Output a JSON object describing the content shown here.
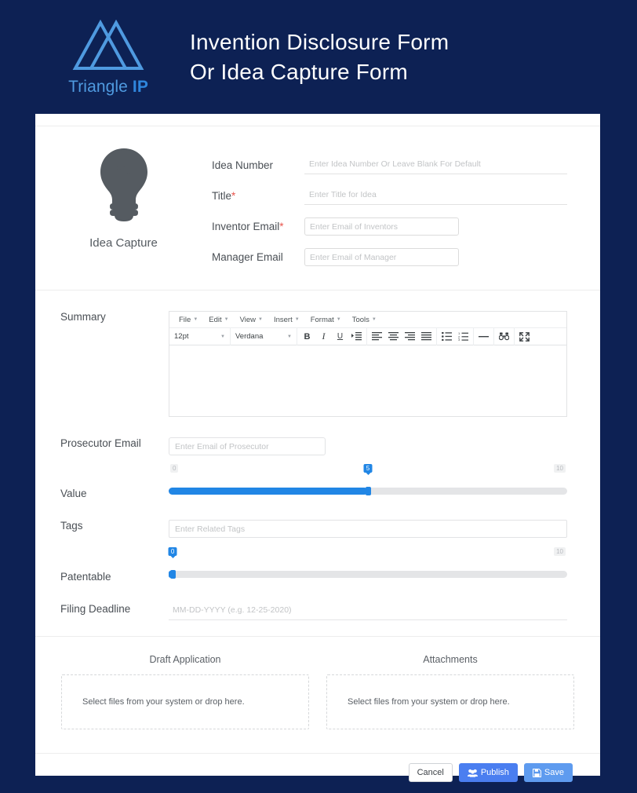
{
  "brand": {
    "logo_icon": "triangle-ip-logo-icon",
    "name_light": "Triangle ",
    "name_bold": "IP"
  },
  "header": {
    "title_line1": "Invention Disclosure Form",
    "title_line2": "Or Idea Capture Form"
  },
  "idea_capture": {
    "icon": "lightbulb-icon",
    "label": "Idea Capture"
  },
  "fields": {
    "idea_number": {
      "label": "Idea Number",
      "placeholder": "Enter Idea Number Or Leave Blank For Default",
      "value": ""
    },
    "title": {
      "label": "Title",
      "required": "*",
      "placeholder": "Enter Title for Idea",
      "value": ""
    },
    "inventor_email": {
      "label": "Inventor Email",
      "required": "*",
      "placeholder": "Enter Email of Inventors",
      "value": ""
    },
    "manager_email": {
      "label": "Manager Email",
      "placeholder": "Enter Email of Manager",
      "value": ""
    },
    "summary": {
      "label": "Summary",
      "value": ""
    },
    "prosecutor_email": {
      "label": "Prosecutor Email",
      "placeholder": "Enter Email of Prosecutor",
      "value": ""
    },
    "value": {
      "label": "Value"
    },
    "tags": {
      "label": "Tags",
      "placeholder": "Enter Related Tags",
      "value": ""
    },
    "patentable": {
      "label": "Patentable"
    },
    "filing_deadline": {
      "label": "Filing Deadline",
      "placeholder": "MM-DD-YYYY (e.g. 12-25-2020)",
      "value": ""
    }
  },
  "editor": {
    "menu": [
      {
        "label": "File"
      },
      {
        "label": "Edit"
      },
      {
        "label": "View"
      },
      {
        "label": "Insert"
      },
      {
        "label": "Format"
      },
      {
        "label": "Tools"
      }
    ],
    "font_size": "12pt",
    "font_family": "Verdana",
    "buttons": [
      {
        "name": "bold-icon",
        "label": "B"
      },
      {
        "name": "italic-icon",
        "label": "I"
      },
      {
        "name": "underline-icon",
        "label": "U"
      },
      {
        "name": "indent-icon",
        "label": ""
      },
      {
        "name": "align-left-icon",
        "label": ""
      },
      {
        "name": "align-center-icon",
        "label": ""
      },
      {
        "name": "align-right-icon",
        "label": ""
      },
      {
        "name": "align-justify-icon",
        "label": ""
      },
      {
        "name": "bullet-list-icon",
        "label": ""
      },
      {
        "name": "numbered-list-icon",
        "label": ""
      },
      {
        "name": "horizontal-rule-icon",
        "label": ""
      },
      {
        "name": "find-replace-icon",
        "label": ""
      },
      {
        "name": "fullscreen-icon",
        "label": ""
      }
    ],
    "content": ""
  },
  "sliders": {
    "value": {
      "min_label": "0",
      "max_label": "10",
      "current": "5",
      "percent": 50
    },
    "patentable": {
      "min_label": "0",
      "max_label": "10",
      "current": "0",
      "percent": 0
    }
  },
  "uploads": [
    {
      "title": "Draft Application",
      "drop_text": "Select files from your system or drop here."
    },
    {
      "title": "Attachments",
      "drop_text": "Select files from your system or drop here."
    }
  ],
  "footer": {
    "cancel": "Cancel",
    "publish": "Publish",
    "save": "Save"
  },
  "colors": {
    "page_background": "#0d2154",
    "brand_blue": "#4f9ae0",
    "slider_blue": "#2186e5",
    "publish_blue": "#4a7ef0",
    "save_blue": "#5e9bef",
    "required_red": "#e8564e"
  }
}
